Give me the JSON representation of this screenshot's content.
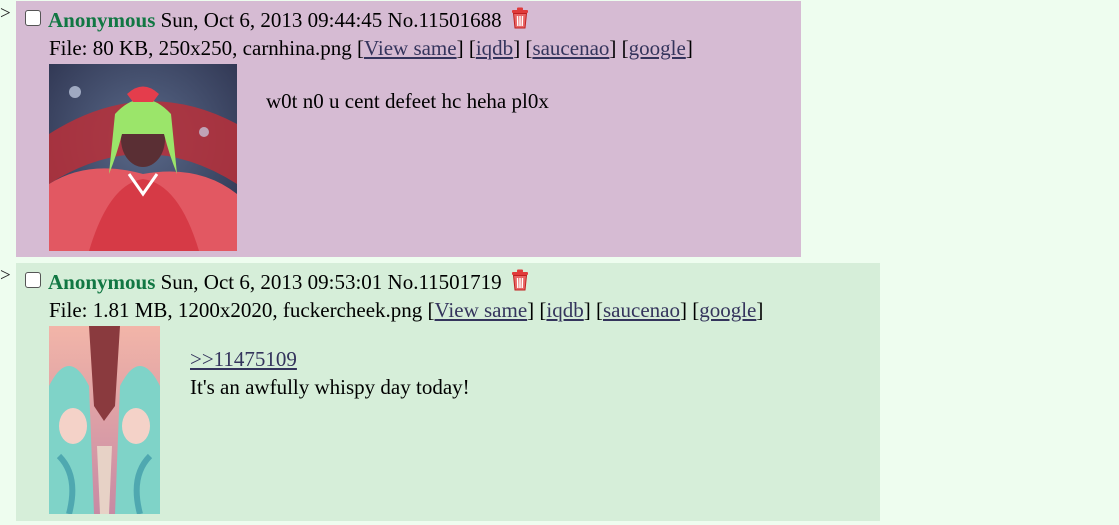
{
  "posts": [
    {
      "name": "Anonymous",
      "datetime": "Sun, Oct 6, 2013 09:44:45",
      "number": "No.11501688",
      "file": {
        "prefix": "File: 80 KB, 250x250, carnhina.png",
        "links": [
          "View same",
          "iqdb",
          "saucenao",
          "google"
        ]
      },
      "message": "w0t n0 u cent defeet hc heha pl0x",
      "colors": {
        "background": "#d6bbd3"
      }
    },
    {
      "name": "Anonymous",
      "datetime": "Sun, Oct 6, 2013 09:53:01",
      "number": "No.11501719",
      "file": {
        "prefix": "File: 1.81 MB, 1200x2020, fuckercheek.png",
        "links": [
          "View same",
          "iqdb",
          "saucenao",
          "google"
        ]
      },
      "quote": ">>11475109",
      "message": "It's an awfully whispy day today!",
      "colors": {
        "background": "#d6eed9"
      }
    }
  ],
  "colors": {
    "page_bg": "#eefdef",
    "name": "#117743",
    "link": "#34345c",
    "delete_icon": "#e03a3a"
  },
  "icons": {
    "delete": "trash-icon",
    "reply_arrow": ">"
  },
  "arrow_glyph": ">"
}
